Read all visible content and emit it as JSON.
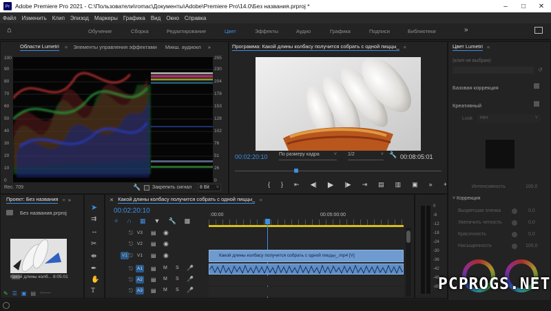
{
  "titlebar": {
    "logo": "Pr",
    "title": "Adobe Premiere Pro 2021 - C:\\Пользователи\\romac\\Документы\\Adobe\\Premiere Pro\\14.0\\Без названия.prproj *"
  },
  "menu": [
    "Файл",
    "Изменить",
    "Клип",
    "Эпизод",
    "Маркеры",
    "Графика",
    "Вид",
    "Окно",
    "Справка"
  ],
  "workspaces": {
    "items": [
      "Обучение",
      "Сборка",
      "Редактирование",
      "Цвет",
      "Эффекты",
      "Аудио",
      "Графика",
      "Подписи",
      "Библиотеки"
    ],
    "active": "Цвет"
  },
  "scopes": {
    "tabs": [
      "Области Lumetri",
      "Элементы управления эффектами",
      "Микш. аудиокл"
    ],
    "left_ticks": [
      "100",
      "90",
      "80",
      "70",
      "60",
      "50",
      "40",
      "30",
      "20",
      "10",
      "0"
    ],
    "right_ticks": [
      "255",
      "230",
      "204",
      "178",
      "153",
      "128",
      "102",
      "76",
      "51",
      "26",
      "0"
    ],
    "footer_left": "Rec. 709",
    "clamp_label": "Закрепить сигнал",
    "bit_depth": "8 Bit"
  },
  "program": {
    "title": "Программа: Какой длины колбасу получится собрать с одной пиццы_",
    "timecode_in": "00:02:20:10",
    "fit": "По размеру кадра",
    "zoom": "1/2",
    "timecode_out": "00:08:05:01"
  },
  "lumetri": {
    "title": "Цвет Lumetri",
    "clip_field": "(клип не выбран)",
    "basic": "Базовая коррекция",
    "creative": "Креативный",
    "look_label": "Look",
    "look_value": "Нет",
    "intensity_label": "Интенсивность",
    "intensity_value": "100,0",
    "correction": "Коррекция",
    "sliders": [
      {
        "label": "Выцветшая пленка",
        "value": "0,0"
      },
      {
        "label": "Увеличить четкость",
        "value": "0,0"
      },
      {
        "label": "Красочность",
        "value": "0,0"
      },
      {
        "label": "Насыщенность",
        "value": "100,0"
      }
    ]
  },
  "project": {
    "title": "Проект: Без названия",
    "file": "Без названия.prproj",
    "clip_name": "Какой длины колб...",
    "clip_duration": "8:05:01"
  },
  "timeline": {
    "title": "Какой длины колбасу получится собрать с одной пиццы_",
    "timecode": "00:02:20:10",
    "ruler_start": ":00:00",
    "ruler_mark": "00:05:00:00",
    "video_clip": "Какой длины колбасу получится собрать с одной пиццы_.mp4 [V]",
    "tracks": [
      {
        "name": "V3",
        "type": "video"
      },
      {
        "name": "V2",
        "type": "video"
      },
      {
        "name": "V1",
        "type": "video"
      },
      {
        "name": "A1",
        "type": "audio"
      },
      {
        "name": "A2",
        "type": "audio"
      },
      {
        "name": "A3",
        "type": "audio"
      }
    ],
    "track_buttons": {
      "mute": "M",
      "solo": "S"
    }
  },
  "meter": {
    "ticks": [
      "0",
      "-6",
      "-12",
      "-18",
      "-24",
      "-30",
      "-36",
      "-42",
      "-48",
      "-dB"
    ]
  },
  "watermark": "PCPROGS.NET",
  "colors": {
    "accent": "#3d8fe3",
    "video_clip": "#6f9bd0",
    "audio_clip": "#5e8ec8",
    "work_bar": "#d8c018"
  }
}
